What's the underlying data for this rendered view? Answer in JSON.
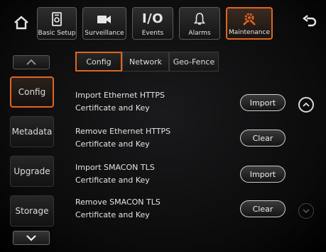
{
  "top_nav": {
    "home_icon": "home-icon",
    "back_icon": "back-arrow-icon",
    "items": [
      {
        "label": "Basic Setup",
        "icon": "settings-panel-icon"
      },
      {
        "label": "Surveillance",
        "icon": "camera-icon"
      },
      {
        "label": "Events",
        "icon": "io-icon",
        "icon_text": "I/O"
      },
      {
        "label": "Alarms",
        "icon": "bell-icon"
      },
      {
        "label": "Maintenance",
        "icon": "tools-icon",
        "active": true
      }
    ],
    "accent_color": "#e2651c"
  },
  "sidebar": {
    "items": [
      {
        "label": "Config",
        "active": true
      },
      {
        "label": "Metadata"
      },
      {
        "label": "Upgrade"
      },
      {
        "label": "Storage"
      }
    ]
  },
  "tabs": [
    {
      "label": "Config",
      "active": true
    },
    {
      "label": "Network"
    },
    {
      "label": "Geo-Fence"
    }
  ],
  "rows": [
    {
      "line1": "Import Ethernet HTTPS",
      "line2": "Certificate and Key",
      "button": "Import"
    },
    {
      "line1": "Remove Ethernet HTTPS",
      "line2": "Certificate and Key",
      "button": "Clear"
    },
    {
      "line1": "Import SMACON TLS",
      "line2": "Certificate and Key",
      "button": "Import"
    },
    {
      "line1": "Remove SMACON TLS",
      "line2": "Certificate and Key",
      "button": "Clear"
    }
  ]
}
